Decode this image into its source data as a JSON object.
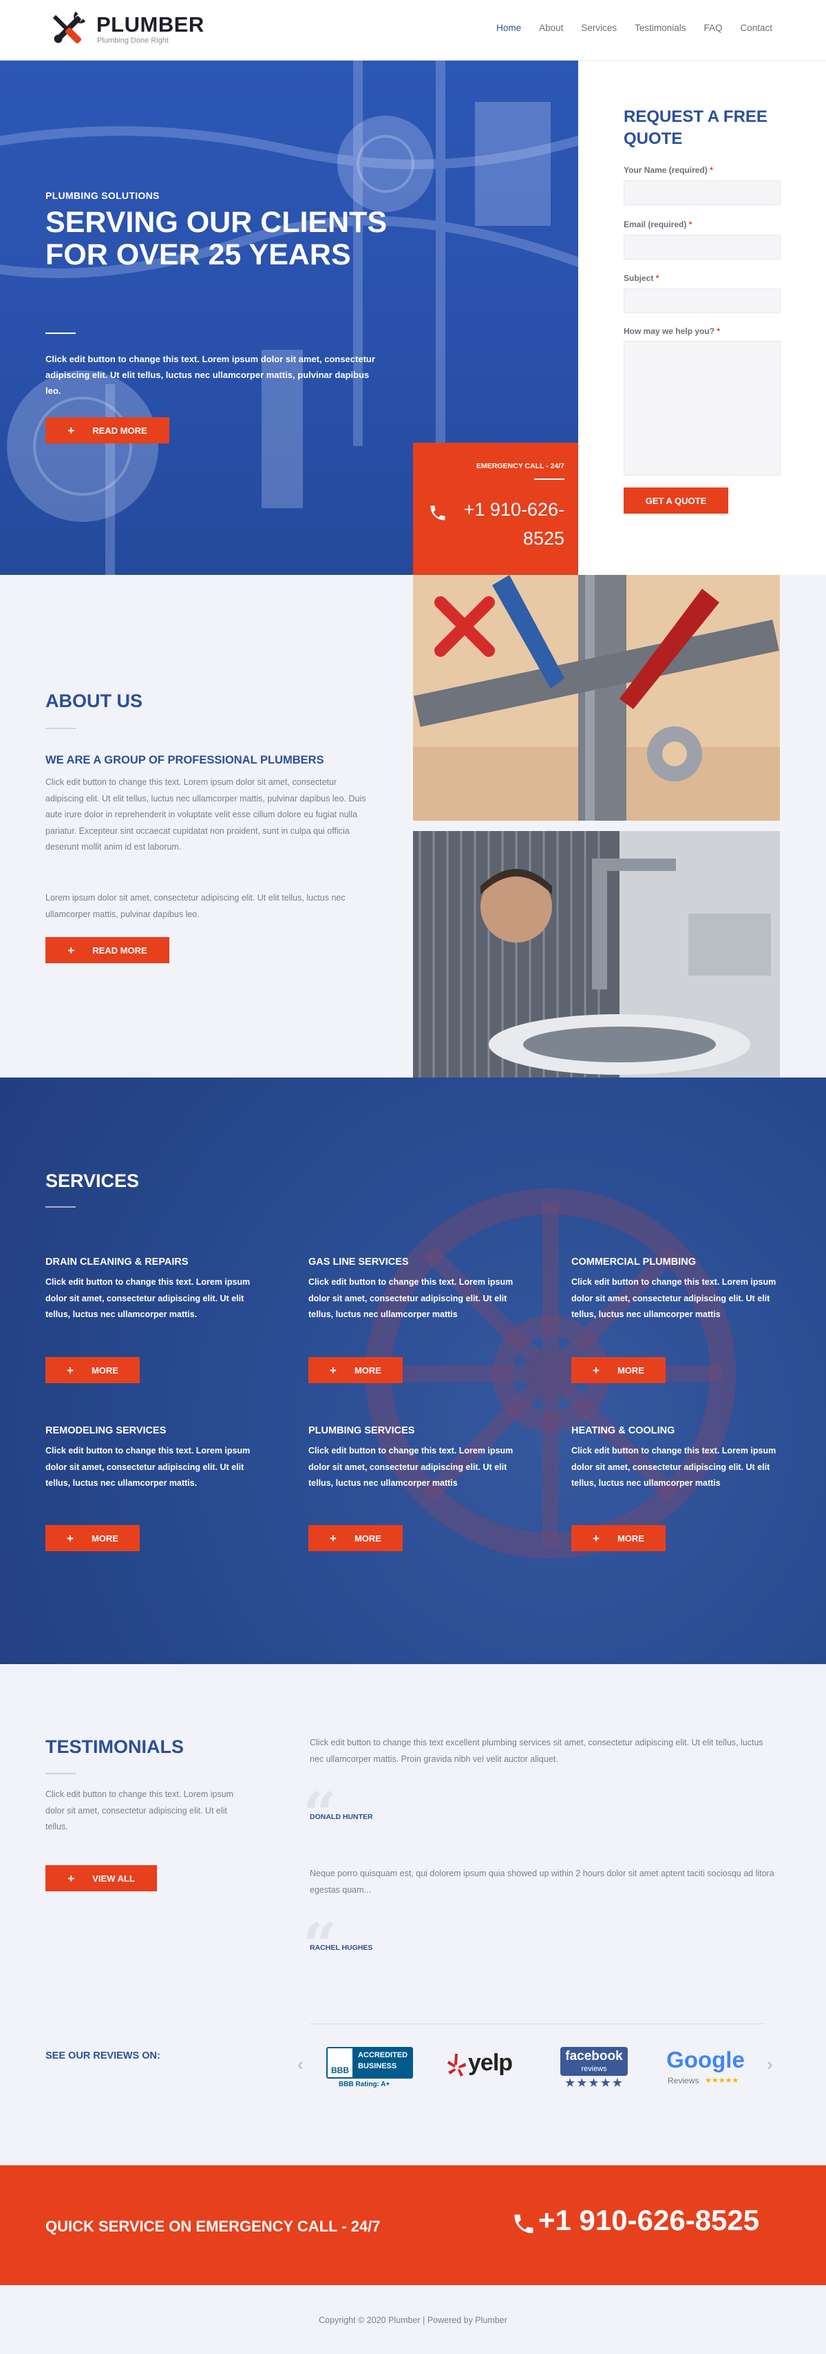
{
  "header": {
    "brand": "PLUMBER",
    "tagline": "Plumbing Done Right",
    "nav": [
      "Home",
      "About",
      "Services",
      "Testimonials",
      "FAQ",
      "Contact"
    ],
    "logo_icon": "crossed-wrench-and-screwdriver-icon"
  },
  "hero": {
    "kicker": "PLUMBING SOLUTIONS",
    "title": "SERVING OUR CLIENTS FOR OVER 25 YEARS",
    "text": "Click edit button to change this text. Lorem ipsum dolor sit amet, consectetur adipiscing elit. Ut elit tellus, luctus nec ullamcorper mattis, pulvinar dapibus leo.",
    "button": "READ MORE"
  },
  "emergency_box": {
    "label": "EMERGENCY CALL - 24/7",
    "phone": "+1 910-626-8525",
    "icon": "phone-icon"
  },
  "quote_form": {
    "title": "REQUEST A FREE QUOTE",
    "fields": [
      {
        "label": "Your Name (required)",
        "required_mark": "*"
      },
      {
        "label": "Email (required)",
        "required_mark": "*"
      },
      {
        "label": "Subject",
        "required_mark": "*"
      },
      {
        "label": "How may we help you?",
        "required_mark": "*"
      }
    ],
    "button": "GET A QUOTE"
  },
  "about": {
    "title": "ABOUT US",
    "subtitle": "WE ARE A GROUP OF PROFESSIONAL PLUMBERS",
    "paragraph1": "Click edit button to change this text. Lorem ipsum dolor sit amet, consectetur adipiscing elit. Ut elit tellus, luctus nec ullamcorper mattis, pulvinar dapibus leo. Duis aute irure dolor in reprehenderit in voluptate velit esse cillum dolore eu fugiat nulla pariatur. Excepteur sint occaecat cupidatat non proident, sunt in culpa qui officia deserunt mollit anim id est laborum.",
    "paragraph2": "Lorem ipsum dolor sit amet, consectetur adipiscing elit. Ut elit tellus, luctus nec ullamcorper mattis, pulvinar dapibus leo.",
    "button": "READ MORE"
  },
  "services": {
    "title": "SERVICES",
    "button": "MORE",
    "items": [
      {
        "title": "DRAIN CLEANING & REPAIRS",
        "text": "Click edit button to change this text. Lorem ipsum dolor sit amet, consectetur adipiscing elit. Ut elit tellus, luctus nec ullamcorper mattis."
      },
      {
        "title": "GAS LINE SERVICES",
        "text": "Click edit button to change this text. Lorem ipsum dolor sit amet, consectetur adipiscing elit. Ut elit tellus, luctus nec ullamcorper mattis"
      },
      {
        "title": "COMMERCIAL PLUMBING",
        "text": "Click edit button to change this text. Lorem ipsum dolor sit amet, consectetur adipiscing elit. Ut elit tellus, luctus nec ullamcorper mattis"
      },
      {
        "title": "REMODELING SERVICES",
        "text": "Click edit button to change this text. Lorem ipsum dolor sit amet, consectetur adipiscing elit. Ut elit tellus, luctus nec ullamcorper mattis."
      },
      {
        "title": "PLUMBING SERVICES",
        "text": "Click edit button to change this text. Lorem ipsum dolor sit amet, consectetur adipiscing elit. Ut elit tellus, luctus nec ullamcorper mattis"
      },
      {
        "title": "HEATING & COOLING",
        "text": "Click edit button to change this text. Lorem ipsum dolor sit amet, consectetur adipiscing elit. Ut elit tellus, luctus nec ullamcorper mattis"
      }
    ]
  },
  "testimonials": {
    "title": "TESTIMONIALS",
    "intro": "Click edit button to change this text. Lorem ipsum dolor sit amet, consectetur adipiscing elit. Ut elit tellus.",
    "button": "VIEW ALL",
    "quotes": [
      {
        "text": "Click edit button to change this text excellent plumbing services sit amet, consectetur adipiscing elit. Ut elit tellus, luctus nec ullamcorper mattis. Proin gravida nibh vel velit auctor aliquet.",
        "author": "DONALD HUNTER"
      },
      {
        "text": "Neque porro quisquam est, qui dolorem ipsum quia showed up within 2 hours dolor sit amet aptent taciti sociosqu ad litora egestas quam...",
        "author": "RACHEL HUGHES"
      }
    ]
  },
  "reviews": {
    "label": "SEE OUR REVIEWS ON:",
    "bbb": {
      "line1": "ACCREDITED",
      "line2": "BUSINESS",
      "rating": "BBB Rating: A+",
      "mark": "BBB"
    },
    "yelp": "yelp",
    "facebook": {
      "name": "facebook",
      "sub": "reviews",
      "stars": "★★★★★"
    },
    "google": {
      "name": "Google",
      "sub": "Reviews",
      "stars": "★★★★★"
    },
    "colors": {
      "bbb": "#005a8c",
      "yelp": "#d32323",
      "facebook": "#3b5998",
      "google_stars": "#f4b400"
    }
  },
  "emergency_band": {
    "text": "QUICK SERVICE ON EMERGENCY CALL - 24/7",
    "phone": "+1 910-626-8525"
  },
  "footer": {
    "text": "Copyright © 2020 Plumber | Powered by Plumber"
  },
  "colors": {
    "primary": "#2a4f9a",
    "accent": "#e7401d",
    "light_bg": "#f2f3f8"
  }
}
